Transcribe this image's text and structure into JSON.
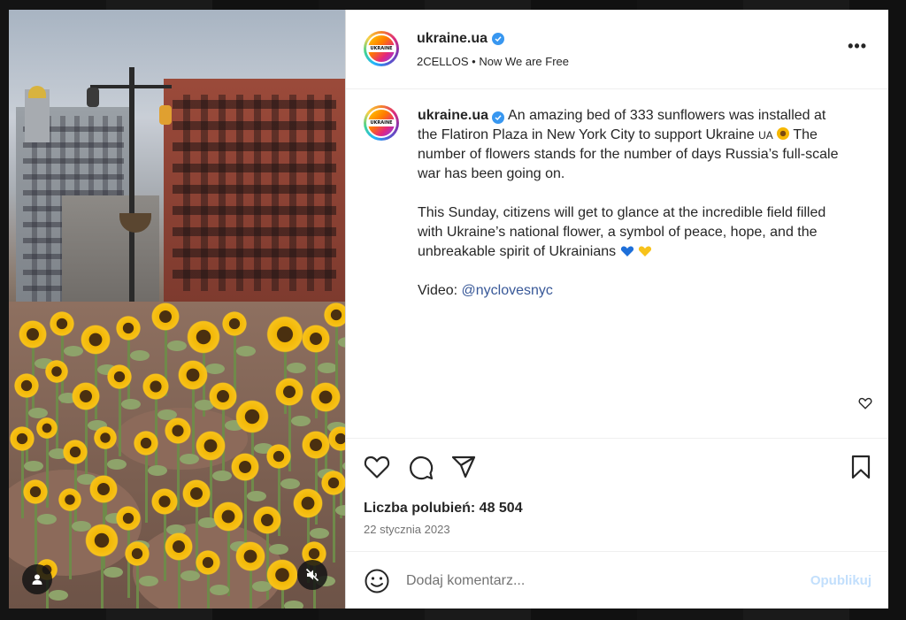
{
  "post": {
    "header": {
      "username": "ukraine.ua",
      "audio_artist": "2CELLOS",
      "separator": "•",
      "audio_track": "Now We are Free",
      "avatar_tag": "UKRAINE"
    },
    "caption": {
      "username": "ukraine.ua",
      "paragraph_1_a": " An amazing bed of 333 sunflowers was installed at the Flatiron Plaza in New York City to support Ukraine ",
      "flag_text": "UA",
      "paragraph_1_b": " The number of flowers stands for the number of days Russia’s full-scale war has been going on.",
      "paragraph_2": "This Sunday, citizens will get to glance at the incredible field filled with Ukraine’s national flower, a symbol of peace, hope, and the unbreakable spirit of Ukrainians ",
      "video_label": "Video: ",
      "video_link": "@nyclovesnyc"
    },
    "likes_label": "Liczba polubień: 48 504",
    "date": "22 stycznia 2023"
  },
  "comment": {
    "placeholder": "Dodaj komentarz...",
    "publish_label": "Opublikuj"
  },
  "icons": {
    "more": "more-options-icon",
    "like": "heart-icon",
    "comment": "comment-icon",
    "share": "send-icon",
    "save": "bookmark-icon",
    "emoji": "emoji-icon",
    "mute": "muted-speaker-icon",
    "tagged_user": "user-icon"
  },
  "colors": {
    "verified": "#3897f0",
    "link": "#385898",
    "publish_disabled": "#c2dffc",
    "heart_blue": "#1e6fd9",
    "heart_yellow": "#f7c21b"
  }
}
